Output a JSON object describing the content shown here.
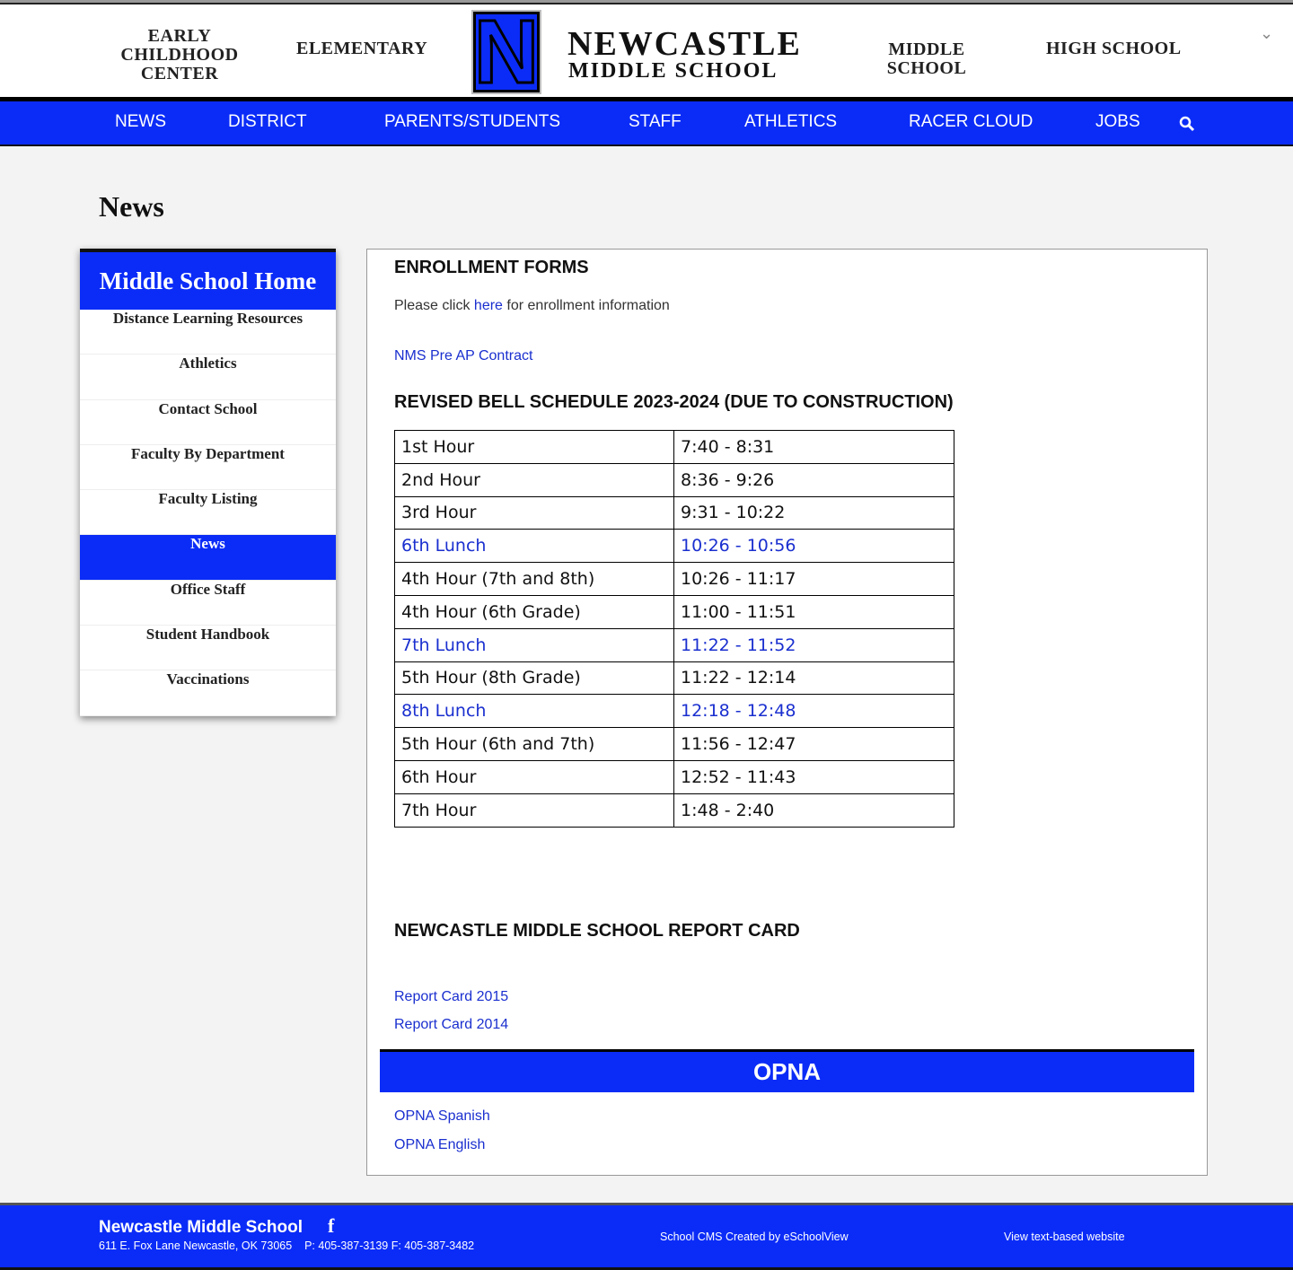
{
  "header": {
    "links": [
      "EARLY CHILDHOOD CENTER",
      "ELEMENTARY",
      "MIDDLE SCHOOL",
      "HIGH SCHOOL"
    ],
    "brand_line1": "NEWCASTLE",
    "brand_line2": "MIDDLE SCHOOL",
    "logo_letter": "N"
  },
  "nav": [
    "NEWS",
    "DISTRICT",
    "PARENTS/STUDENTS",
    "STAFF",
    "ATHLETICS",
    "RACER CLOUD",
    "JOBS"
  ],
  "page_title": "News",
  "sidebar": {
    "heading": "Middle School Home",
    "items": [
      "Distance Learning Resources",
      "Athletics",
      "Contact School",
      "Faculty By Department",
      "Faculty Listing",
      "News",
      "Office Staff",
      "Student Handbook",
      "Vaccinations"
    ],
    "active": "News"
  },
  "main": {
    "enroll_title": "ENROLLMENT FORMS",
    "enroll_pre": "Please click ",
    "enroll_link": "here",
    "enroll_post": " for enrollment information",
    "preap_link": "NMS Pre AP Contract",
    "bell_title": "REVISED BELL SCHEDULE 2023-2024 (DUE TO CONSTRUCTION)",
    "schedule": [
      [
        "1st Hour",
        "7:40 - 8:31"
      ],
      [
        "2nd Hour",
        "8:36 - 9:26"
      ],
      [
        "3rd Hour",
        "9:31 - 10:22"
      ],
      [
        "6th Lunch",
        "10:26 - 10:56"
      ],
      [
        "4th Hour (7th and 8th)",
        "10:26 - 11:17"
      ],
      [
        "4th Hour (6th Grade)",
        "11:00 - 11:51"
      ],
      [
        "7th Lunch",
        "11:22 - 11:52"
      ],
      [
        "5th Hour (8th Grade)",
        "11:22 - 12:14"
      ],
      [
        "8th Lunch",
        "12:18 - 12:48"
      ],
      [
        "5th Hour (6th and 7th)",
        "11:56 - 12:47"
      ],
      [
        "6th Hour",
        "12:52 - 11:43"
      ],
      [
        "7th Hour",
        "1:48 - 2:40"
      ]
    ],
    "report_title": "NEWCASTLE MIDDLE SCHOOL REPORT CARD",
    "report_links": [
      "Report Card 2015",
      "Report Card 2014"
    ],
    "opna_title": "OPNA",
    "opna_links": [
      "OPNA Spanish",
      "OPNA English"
    ]
  },
  "footer": {
    "name": "Newcastle Middle School",
    "address": "611 E. Fox Lane Newcastle, OK 73065",
    "phones": "P: 405-387-3139 F: 405-387-3482",
    "cms": "School CMS Created by eSchoolView",
    "text_site": "View text-based website"
  },
  "colors": {
    "brand_blue": "#0b2cf7",
    "link": "#1a2fcf"
  }
}
